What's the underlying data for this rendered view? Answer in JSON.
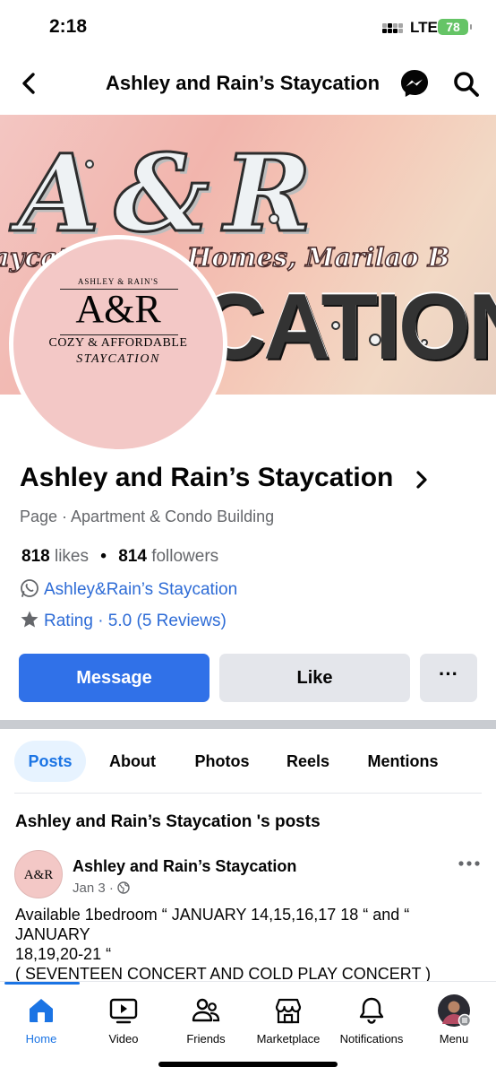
{
  "status": {
    "time": "2:18",
    "network": "LTE",
    "battery": "78"
  },
  "header": {
    "title": "Ashley and Rain’s Staycation"
  },
  "cover": {
    "monogram": "A&R",
    "subtitle": "aycat      n Deca Homes, Marilao B",
    "headline": "CATION"
  },
  "profile_pic": {
    "line1": "ASHLEY & RAIN'S",
    "monogram": "A&R",
    "line2": "COZY & AFFORDABLE",
    "line3": "STAYCATION"
  },
  "page": {
    "name": "Ashley and Rain’s Staycation",
    "category": "Page · Apartment & Condo Building",
    "likes_count": "818",
    "likes_label": "likes",
    "followers_count": "814",
    "followers_label": "followers",
    "whatsapp": "Ashley&Rain’s Staycation",
    "rating": "Rating · 5.0 (5 Reviews)"
  },
  "actions": {
    "message": "Message",
    "like": "Like",
    "more": "···"
  },
  "tabs": [
    {
      "label": "Posts",
      "active": true
    },
    {
      "label": "About"
    },
    {
      "label": "Photos"
    },
    {
      "label": "Reels"
    },
    {
      "label": "Mentions"
    }
  ],
  "posts_heading": "Ashley and Rain’s Staycation 's posts",
  "post": {
    "avatar_text": "A&R",
    "author": "Ashley and Rain’s Staycation",
    "date": "Jan 3 ·",
    "line1": "Available 1bedroom “ JANUARY 14,15,16,17 18 “ and “ JANUARY",
    "line2": "18,19,20-21 “",
    "line3": "( SEVENTEEN CONCERT AND COLD PLAY CONCERT )"
  },
  "bottom_nav": [
    {
      "label": "Home",
      "active": true
    },
    {
      "label": "Video"
    },
    {
      "label": "Friends"
    },
    {
      "label": "Marketplace"
    },
    {
      "label": "Notifications"
    },
    {
      "label": "Menu"
    }
  ],
  "colors": {
    "accent": "#1b74e4",
    "message_button": "#3071e8",
    "secondary_button": "#e4e6eb",
    "link": "#2d6bd6",
    "muted": "#65676b"
  }
}
